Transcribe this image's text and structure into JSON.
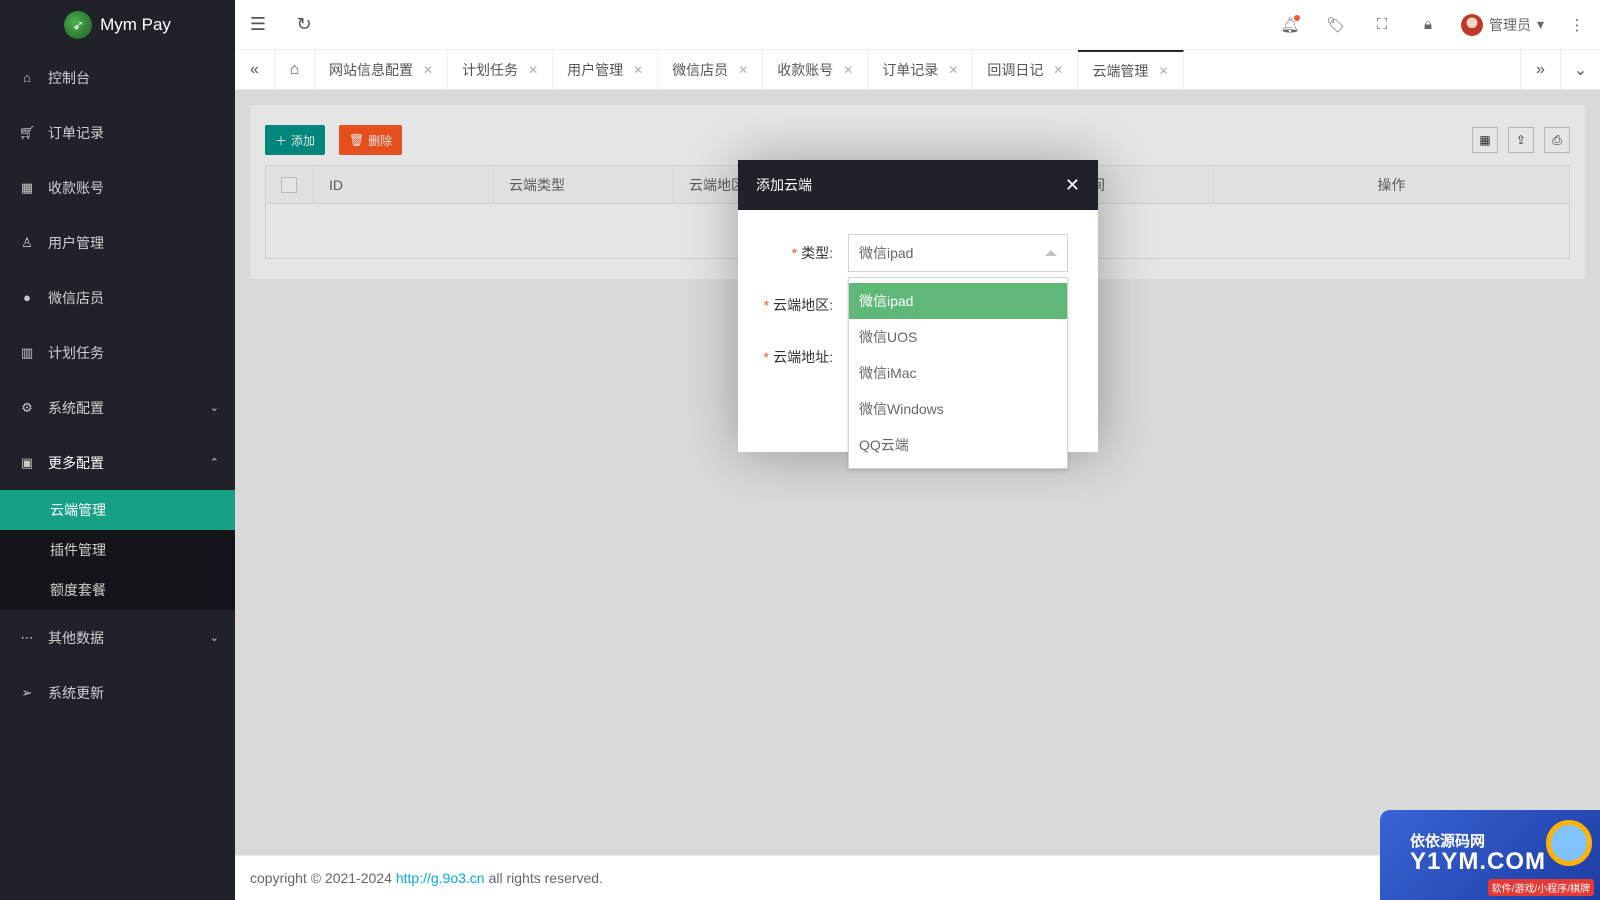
{
  "app": {
    "name": "Mym Pay"
  },
  "sidebar": {
    "items": [
      {
        "label": "控制台",
        "icon": "home-icon"
      },
      {
        "label": "订单记录",
        "icon": "cart-icon"
      },
      {
        "label": "收款账号",
        "icon": "apps-icon"
      },
      {
        "label": "用户管理",
        "icon": "user-icon"
      },
      {
        "label": "微信店员",
        "icon": "wechat-icon"
      },
      {
        "label": "计划任务",
        "icon": "book-icon"
      },
      {
        "label": "系统配置",
        "icon": "gear-icon"
      },
      {
        "label": "更多配置",
        "icon": "grid-icon"
      },
      {
        "label": "其他数据",
        "icon": "more-icon"
      },
      {
        "label": "系统更新",
        "icon": "send-icon"
      }
    ],
    "sub_items": [
      "云端管理",
      "插件管理",
      "额度套餐"
    ]
  },
  "header": {
    "user": "管理员"
  },
  "tabs": [
    "网站信息配置",
    "计划任务",
    "用户管理",
    "微信店员",
    "收款账号",
    "订单记录",
    "回调日记",
    "云端管理"
  ],
  "toolbar": {
    "add": "添加",
    "delete": "删除"
  },
  "table": {
    "columns": [
      "ID",
      "云端类型",
      "云端地区",
      "添加时间",
      "操作"
    ]
  },
  "modal": {
    "title": "添加云端",
    "fields": [
      {
        "label": "类型:",
        "value": "微信ipad"
      },
      {
        "label": "云端地区:"
      },
      {
        "label": "云端地址:"
      }
    ],
    "options": [
      "微信ipad",
      "微信UOS",
      "微信iMac",
      "微信Windows",
      "QQ云端"
    ]
  },
  "footer": {
    "prefix": "copyright © 2021-2024",
    "link": "http://g.9o3.cn",
    "suffix": "all rights reserved."
  },
  "watermark": {
    "line1": "依依源码网",
    "line2": "Y1YM.COM",
    "line3": "软件/游戏/小程序/棋牌"
  },
  "colors": {
    "sidebar": "#20222a",
    "accent": "#16a085",
    "primary": "#009688",
    "danger": "#ff5722",
    "selected": "#5fb878"
  }
}
